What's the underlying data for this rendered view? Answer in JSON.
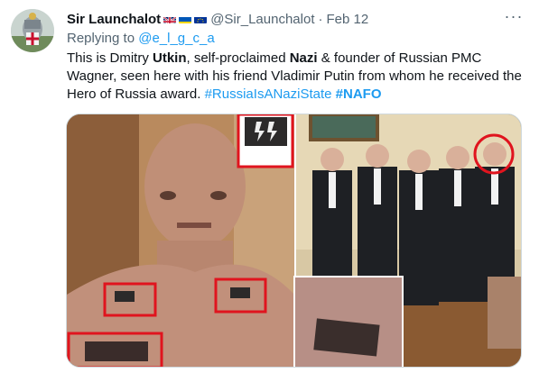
{
  "author": {
    "name": "Sir Launchalot",
    "handle": "@Sir_Launchalot",
    "separator": "·",
    "date": "Feb 12",
    "flags": [
      "uk-flag-icon",
      "ukraine-flag-icon",
      "eu-flag-icon"
    ]
  },
  "reply": {
    "prefix": "Replying to",
    "mention": "@e_l_g_c_a"
  },
  "tweet": {
    "t1": "This is Dmitry ",
    "b1": "Utkin",
    "t2": ", self-proclaimed ",
    "b2": "Nazi",
    "t3": " & founder of Russian PMC Wagner, seen here with his friend Vladimir Putin from whom he received the Hero of Russia award. ",
    "hashtag1": "#RussiaIsANaziState",
    "space": " ",
    "hashtag2": "#NAFO"
  },
  "more_label": "···",
  "colors": {
    "link": "#1d9bf0",
    "secondary_text": "#536471",
    "highlight_box": "#e0141e"
  }
}
